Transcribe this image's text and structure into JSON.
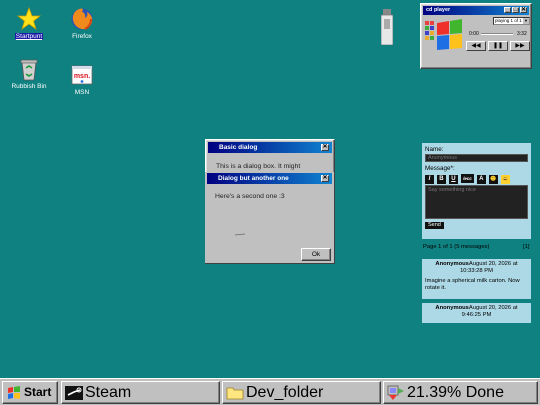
{
  "desktop": {
    "icons": [
      {
        "label": "Startpunt",
        "icon": "star-icon"
      },
      {
        "label": "Firefox",
        "icon": "firefox-icon"
      },
      {
        "label": "Rubbish Bin",
        "icon": "recycle-bin-icon"
      },
      {
        "label": "MSN",
        "icon": "msn-icon"
      }
    ]
  },
  "dialogs": {
    "basic": {
      "title": "Basic dialog",
      "text": "This is a dialog box. It might",
      "close": "✕"
    },
    "second": {
      "title": "Dialog but another one",
      "text": "Here's a second one :3",
      "close": "✕",
      "ok_label": "Ok"
    }
  },
  "player": {
    "title": "cd player",
    "track_select": "playing 1 of 1",
    "time_current": "0:00",
    "time_total": "3:32",
    "controls": {
      "prev": "◀◀",
      "pause": "❚❚",
      "next": "▶▶"
    },
    "title_buttons": {
      "minimize": "_",
      "maximize": "□",
      "close": "✕"
    }
  },
  "guestbook": {
    "name_label": "Name:",
    "name_placeholder": "Anonymous",
    "message_label": "Message*:",
    "format_buttons": [
      "I",
      "B",
      "U",
      "/ecc",
      "A",
      "🙂",
      "😀"
    ],
    "message_placeholder": "Say something nice",
    "send_label": "Send",
    "pagination": "Page 1 of 1 (5 messages)",
    "page_link": "[1]",
    "comments": [
      {
        "author": "Anonymous",
        "date": "August 20, 2026 at",
        "time": "10:33:28 PM",
        "body": "Imagine a spherical milk carton. Now rotate it."
      },
      {
        "author": "Anonymous",
        "date": "August 20, 2026 at",
        "time": "9:46:25 PM",
        "body": ""
      }
    ]
  },
  "taskbar": {
    "start_label": "Start",
    "tasks": [
      {
        "label": "Steam",
        "icon": "steam-icon"
      },
      {
        "label": "Dev_folder",
        "icon": "folder-icon"
      },
      {
        "label": "21.39% Done",
        "icon": "progress-icon"
      }
    ]
  },
  "colors": {
    "desktop": "#0f8180",
    "titlebar": "#000080",
    "guestbook": "#add8e6"
  }
}
